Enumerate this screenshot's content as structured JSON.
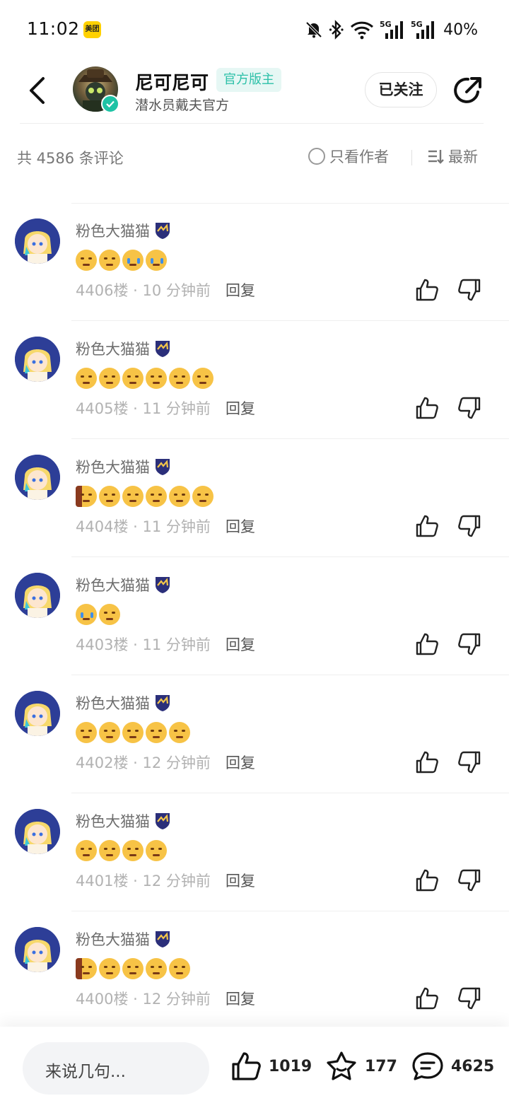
{
  "status_bar": {
    "time": "11:02",
    "app_badge": "美团",
    "battery": "40%",
    "icons": [
      "mute-bell-icon",
      "bluetooth-icon",
      "wifi-icon",
      "5g-signal-icon",
      "5g-signal-icon"
    ]
  },
  "header": {
    "name": "尼可尼可",
    "tag": "官方版主",
    "subtitle": "潜水员戴夫官方",
    "follow_label": "已关注",
    "accent_color": "#2cc0a8"
  },
  "filter": {
    "count": "共 4586 条评论",
    "author_only": "只看作者",
    "sort": "最新"
  },
  "comments": [
    {
      "user": "粉色大猫猫",
      "emojis": [
        "sleepy",
        "tired",
        "cry",
        "cry"
      ],
      "floor": "4406楼",
      "time": "10 分钟前",
      "reply": "回复"
    },
    {
      "user": "粉色大猫猫",
      "emojis": [
        "smug",
        "smirk",
        "grin",
        "tired",
        "grin",
        "tired"
      ],
      "floor": "4405楼",
      "time": "11 分钟前",
      "reply": "回复"
    },
    {
      "user": "粉色大猫猫",
      "emojis": [
        "wall",
        "smirk",
        "tired",
        "smirk",
        "tired",
        "smirk"
      ],
      "floor": "4404楼",
      "time": "11 分钟前",
      "reply": "回复"
    },
    {
      "user": "粉色大猫猫",
      "emojis": [
        "cry",
        "smirk"
      ],
      "floor": "4403楼",
      "time": "11 分钟前",
      "reply": "回复"
    },
    {
      "user": "粉色大猫猫",
      "emojis": [
        "smug",
        "sleepy",
        "smug",
        "sleepy",
        "smug"
      ],
      "floor": "4402楼",
      "time": "12 分钟前",
      "reply": "回复"
    },
    {
      "user": "粉色大猫猫",
      "emojis": [
        "tired",
        "sleepy",
        "tired",
        "tired"
      ],
      "floor": "4401楼",
      "time": "12 分钟前",
      "reply": "回复"
    },
    {
      "user": "粉色大猫猫",
      "emojis": [
        "wall",
        "sleepy",
        "smirk",
        "smirk",
        "smirk"
      ],
      "floor": "4400楼",
      "time": "12 分钟前",
      "reply": "回复"
    }
  ],
  "bottom": {
    "placeholder": "来说几句...",
    "likes": "1019",
    "stars": "177",
    "comments": "4625"
  }
}
